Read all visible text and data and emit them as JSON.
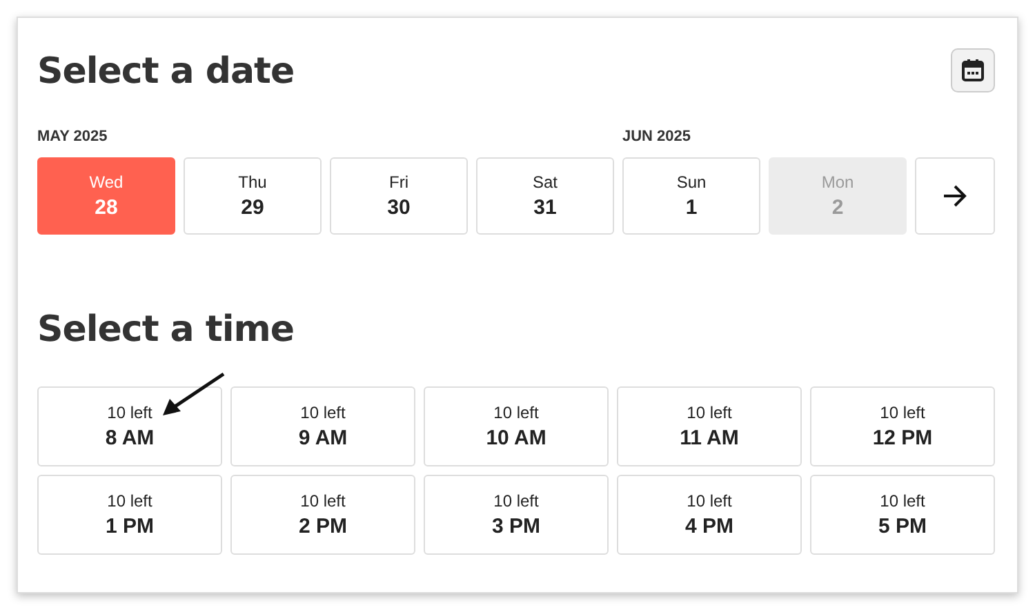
{
  "date_section": {
    "title": "Select a date",
    "days": [
      {
        "month": "MAY 2025",
        "weekday": "Wed",
        "date": "28",
        "selected": true,
        "disabled": false
      },
      {
        "weekday": "Thu",
        "date": "29",
        "selected": false,
        "disabled": false
      },
      {
        "weekday": "Fri",
        "date": "30",
        "selected": false,
        "disabled": false
      },
      {
        "weekday": "Sat",
        "date": "31",
        "selected": false,
        "disabled": false
      },
      {
        "month": "JUN 2025",
        "weekday": "Sun",
        "date": "1",
        "selected": false,
        "disabled": false
      },
      {
        "weekday": "Mon",
        "date": "2",
        "selected": false,
        "disabled": true
      }
    ]
  },
  "time_section": {
    "title": "Select a time",
    "slots": [
      {
        "availability": "10 left",
        "time": "8 AM"
      },
      {
        "availability": "10 left",
        "time": "9 AM"
      },
      {
        "availability": "10 left",
        "time": "10 AM"
      },
      {
        "availability": "10 left",
        "time": "11 AM"
      },
      {
        "availability": "10 left",
        "time": "12 PM"
      },
      {
        "availability": "10 left",
        "time": "1 PM"
      },
      {
        "availability": "10 left",
        "time": "2 PM"
      },
      {
        "availability": "10 left",
        "time": "3 PM"
      },
      {
        "availability": "10 left",
        "time": "4 PM"
      },
      {
        "availability": "10 left",
        "time": "5 PM"
      }
    ]
  }
}
